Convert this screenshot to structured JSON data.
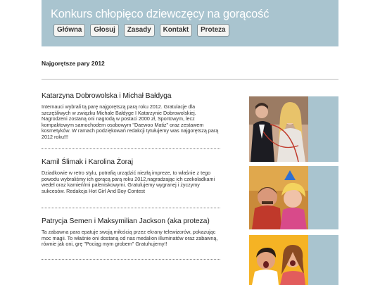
{
  "header": {
    "title": "Konkurs chłopięco dziewczęcy na gorącość",
    "nav": [
      "Główna",
      "Głosuj",
      "Zasady",
      "Kontakt",
      "Proteza"
    ]
  },
  "main": {
    "section_title": "Najgorętsze pary 2012",
    "articles": [
      {
        "title": "Katarzyna Dobrowolska i Michał Bałdyga",
        "text": "Internauci wybrali tą parę najgorętszą parą roku 2012. Gratulacje dla szczęśliwych w związku Michale Bałdyge I Katarzynie Dobrowolskiej. Nagrodzeni zostaną oni nagrodą w postaci 2000 zł, Sportowym, lecz kompaktowym samochodem osobowym \"Daewoo Matiz\" oraz zestawem kosmetyków. W ramach podziękowań redakcji tytułujemy was najgorętszą parą 2012 roku!!!"
      },
      {
        "title": "Kamil Ślimak i Karolina Żoraj",
        "text": "Dziadkowie w retro stylu, potrafią urządzić niezłą impreze, to właśnie z tego powodu wybraliśmy ich gorącą parą roku 2012,nagradzając ich czekoladkami wedel oraz kamień/mi paleniskowymi. Gratulujemy wygranej i życzymy sukcesów. Redakcja Hot Girl And Boy Contest"
      },
      {
        "title": "Patrycja Semen i Maksymilian Jackson (aka proteza)",
        "text": "Ta zabawna para epatuje swoją miłością przez ekrany telewizorów, pokazując moc magii. To właśnie oni dostaną od nas medalion illuminatów oraz zabawną, równie jak oni, grę \"Pociąg mym grobem\" Gratuhujemy!!"
      }
    ]
  }
}
